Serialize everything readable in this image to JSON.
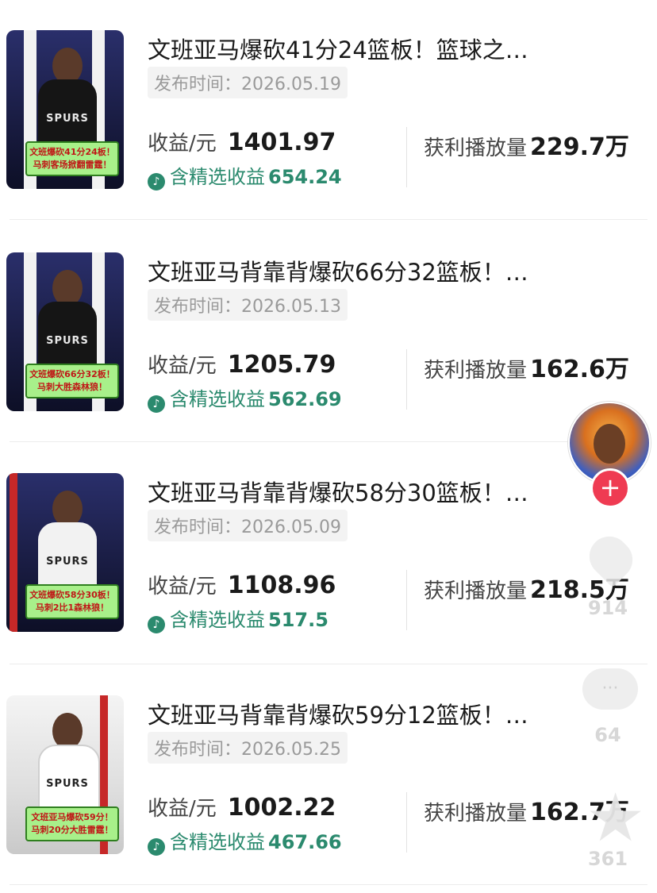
{
  "items": [
    {
      "title": "文班亚马爆砍41分24篮板！篮球之…",
      "date": "发布时间：2026.05.19",
      "revenue_label": "收益/元",
      "revenue": "1401.97",
      "selected_label": "含精选收益",
      "selected": "654.24",
      "plays_label": "获利播放量",
      "plays": "229.7万",
      "thumb_caption": "文班爆砍41分24板！马刺客场掀翻雷霆！",
      "thumb_style": "dark"
    },
    {
      "title": "文班亚马背靠背爆砍66分32篮板！…",
      "date": "发布时间：2026.05.13",
      "revenue_label": "收益/元",
      "revenue": "1205.79",
      "selected_label": "含精选收益",
      "selected": "562.69",
      "plays_label": "获利播放量",
      "plays": "162.6万",
      "thumb_caption": "文班爆砍66分32板！马刺大胜森林狼！",
      "thumb_style": "dark"
    },
    {
      "title": "文班亚马背靠背爆砍58分30篮板！…",
      "date": "发布时间：2026.05.09",
      "revenue_label": "收益/元",
      "revenue": "1108.96",
      "selected_label": "含精选收益",
      "selected": "517.5",
      "plays_label": "获利播放量",
      "plays": "218.5万",
      "thumb_caption": "文班爆砍58分30板！马刺2比1森林狼！",
      "thumb_style": "dark"
    },
    {
      "title": "文班亚马背靠背爆砍59分12篮板！…",
      "date": "发布时间：2026.05.25",
      "revenue_label": "收益/元",
      "revenue": "1002.22",
      "selected_label": "含精选收益",
      "selected": "467.66",
      "plays_label": "获利播放量",
      "plays": "162.7万",
      "thumb_caption": "文班亚马爆砍59分！马刺20分大胜雷霆！",
      "thumb_style": "light"
    }
  ],
  "thumb_jersey": "SPURS",
  "icons": {
    "douyin": "douyin-icon",
    "follow": "plus-icon",
    "like": "heart-icon",
    "comment": "comment-icon",
    "favorite": "star-icon"
  },
  "overlay": {
    "like_count": "914",
    "comment_count": "64",
    "favorite_count": "361",
    "follow_glyph": "+"
  },
  "colors": {
    "accent_green": "#2b8a6e",
    "follow_red": "#ef3b52",
    "caption_bg": "#a8f08a",
    "caption_text": "#c01717"
  }
}
